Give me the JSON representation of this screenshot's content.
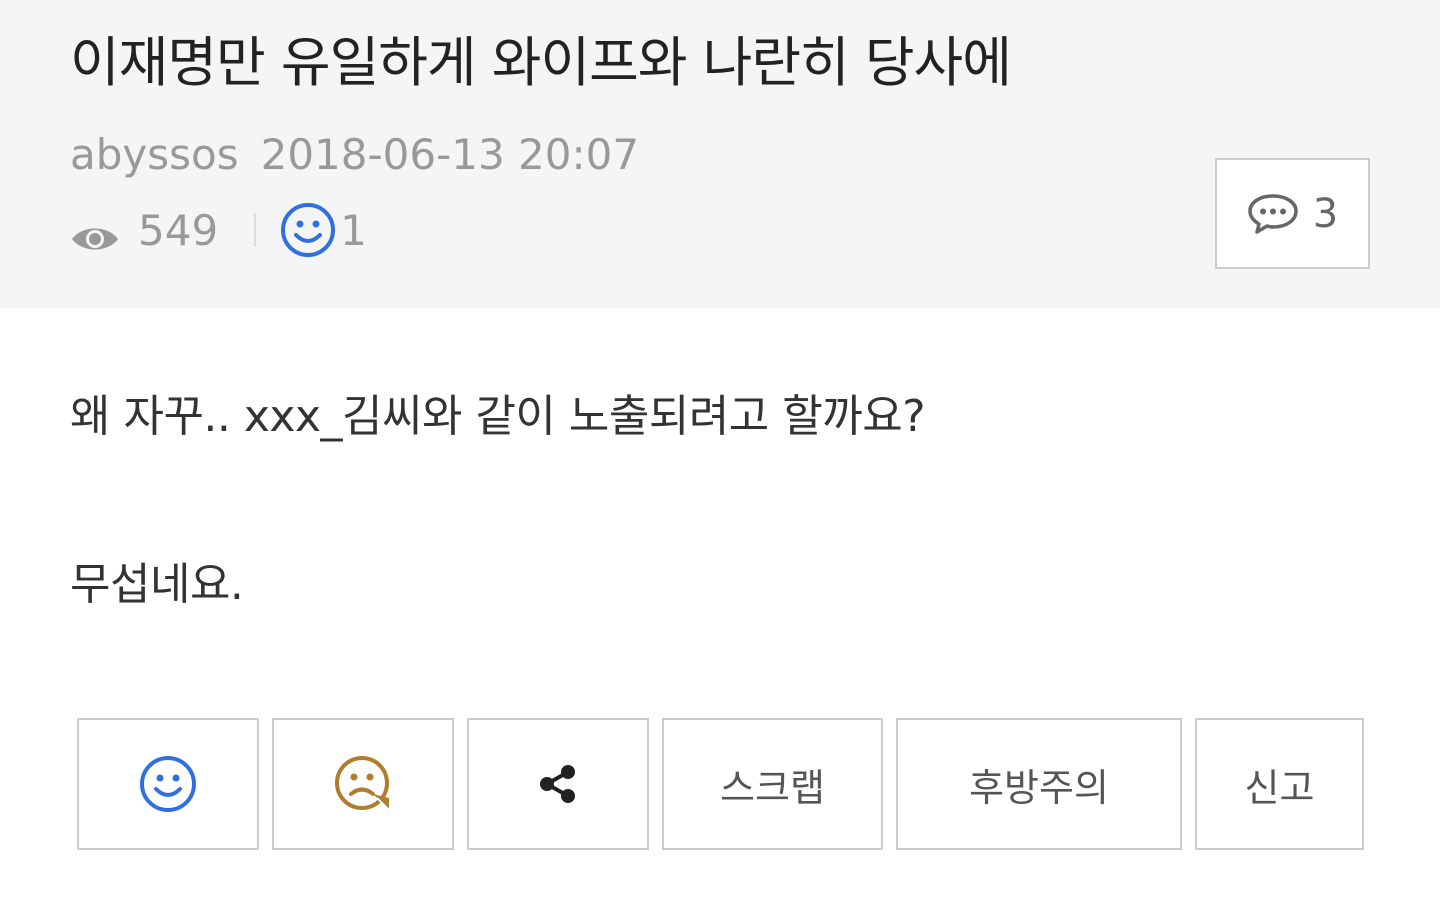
{
  "post": {
    "title": "이재명만 유일하게 와이프와 나란히 당사에",
    "author": "abyssos",
    "date": "2018-06-13 20:07",
    "views": "549",
    "likes": "1",
    "comments": "3",
    "body": [
      "왜 자꾸.. xxx_김씨와 같이 노출되려고 할까요?",
      "무섭네요."
    ]
  },
  "actions": {
    "like_icon": "smile-icon",
    "dislike_icon": "frown-icon",
    "share_icon": "share-icon",
    "scrap_label": "스크랩",
    "caution_label": "후방주의",
    "report_label": "신고"
  },
  "colors": {
    "header_bg": "#f5f5f5",
    "like_blue": "#2f6fe0",
    "dislike_brown": "#b07d2c"
  }
}
